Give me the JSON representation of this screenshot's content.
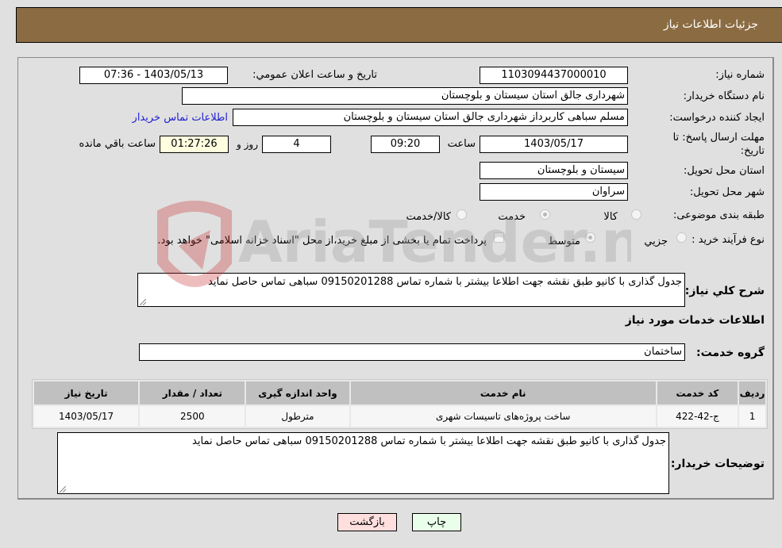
{
  "header": {
    "title": "جزئیات اطلاعات نیاز"
  },
  "form": {
    "need_number": {
      "label": "شماره نیاز:",
      "value": "1103094437000010"
    },
    "announce": {
      "label": "تاریخ و ساعت اعلان عمومي:",
      "value": "1403/05/13 - 07:36"
    },
    "buyer_org": {
      "label": "نام دستگاه خریدار:",
      "value": "شهرداری جالق استان سیستان و بلوچستان"
    },
    "requester": {
      "label": "ایجاد کننده درخواست:",
      "value": "مسلم سباهی کاربرداز شهرداری جالق استان سیستان و بلوچستان",
      "contact_link": "اطلاعات تماس خریدار"
    },
    "deadline": {
      "label": "مهلت ارسال پاسخ: تا تاریخ:",
      "date": "1403/05/17",
      "time_label": "ساعت",
      "time": "09:20",
      "days": "4",
      "days_label": "روز و",
      "remaining": "01:27:26",
      "remaining_label": "ساعت باقي مانده"
    },
    "province": {
      "label": "استان محل تحویل:",
      "value": "سیستان و بلوچستان"
    },
    "city": {
      "label": "شهر محل تحویل:",
      "value": "سراوان"
    },
    "category": {
      "label": "طبقه بندی موضوعی:",
      "options": [
        "کالا",
        "خدمت",
        "کالا/خدمت"
      ],
      "selected": "خدمت"
    },
    "process": {
      "label": "نوع فرآیند خرید :",
      "options": [
        "جزيي",
        "متوسط"
      ],
      "selected": "متوسط",
      "treasury_note": "پرداخت تمام یا بخشی از مبلغ خرید،از محل \"اسناد خزانه اسلامی\" خواهد بود."
    },
    "description": {
      "label": "شرح کلي نیاز:",
      "value": "جدول گذاری با کانیو طبق نقشه جهت اطلاعا بیشتر با شماره تماس 09150201288 سباهی تماس حاصل نماید"
    }
  },
  "services": {
    "section_title": "اطلاعات خدمات مورد نیاز",
    "group_label": "گروه خدمت:",
    "group_value": "ساختمان",
    "columns": [
      "ردیف",
      "کد خدمت",
      "نام خدمت",
      "واحد اندازه گیری",
      "تعداد / مقدار",
      "تاریخ نیاز"
    ],
    "rows": [
      {
        "row": "1",
        "code": "ج-42-422",
        "name": "ساخت پروژه‌های تاسیسات شهری",
        "unit": "مترطول",
        "qty": "2500",
        "date": "1403/05/17"
      }
    ]
  },
  "buyer_notes": {
    "label": "توضیحات خریدار:",
    "value": "جدول گذاری با کانیو طبق نقشه جهت اطلاعا بیشتر با شماره تماس 09150201288 سباهی تماس حاصل نماید"
  },
  "buttons": {
    "print": "چاپ",
    "back": "بازگشت"
  },
  "colors": {
    "header": "#8b6c42",
    "print_bg": "#eaffea",
    "back_bg": "#ffdede",
    "link": "#2020d0"
  },
  "watermark": {
    "text": "AriaTender.neT"
  }
}
